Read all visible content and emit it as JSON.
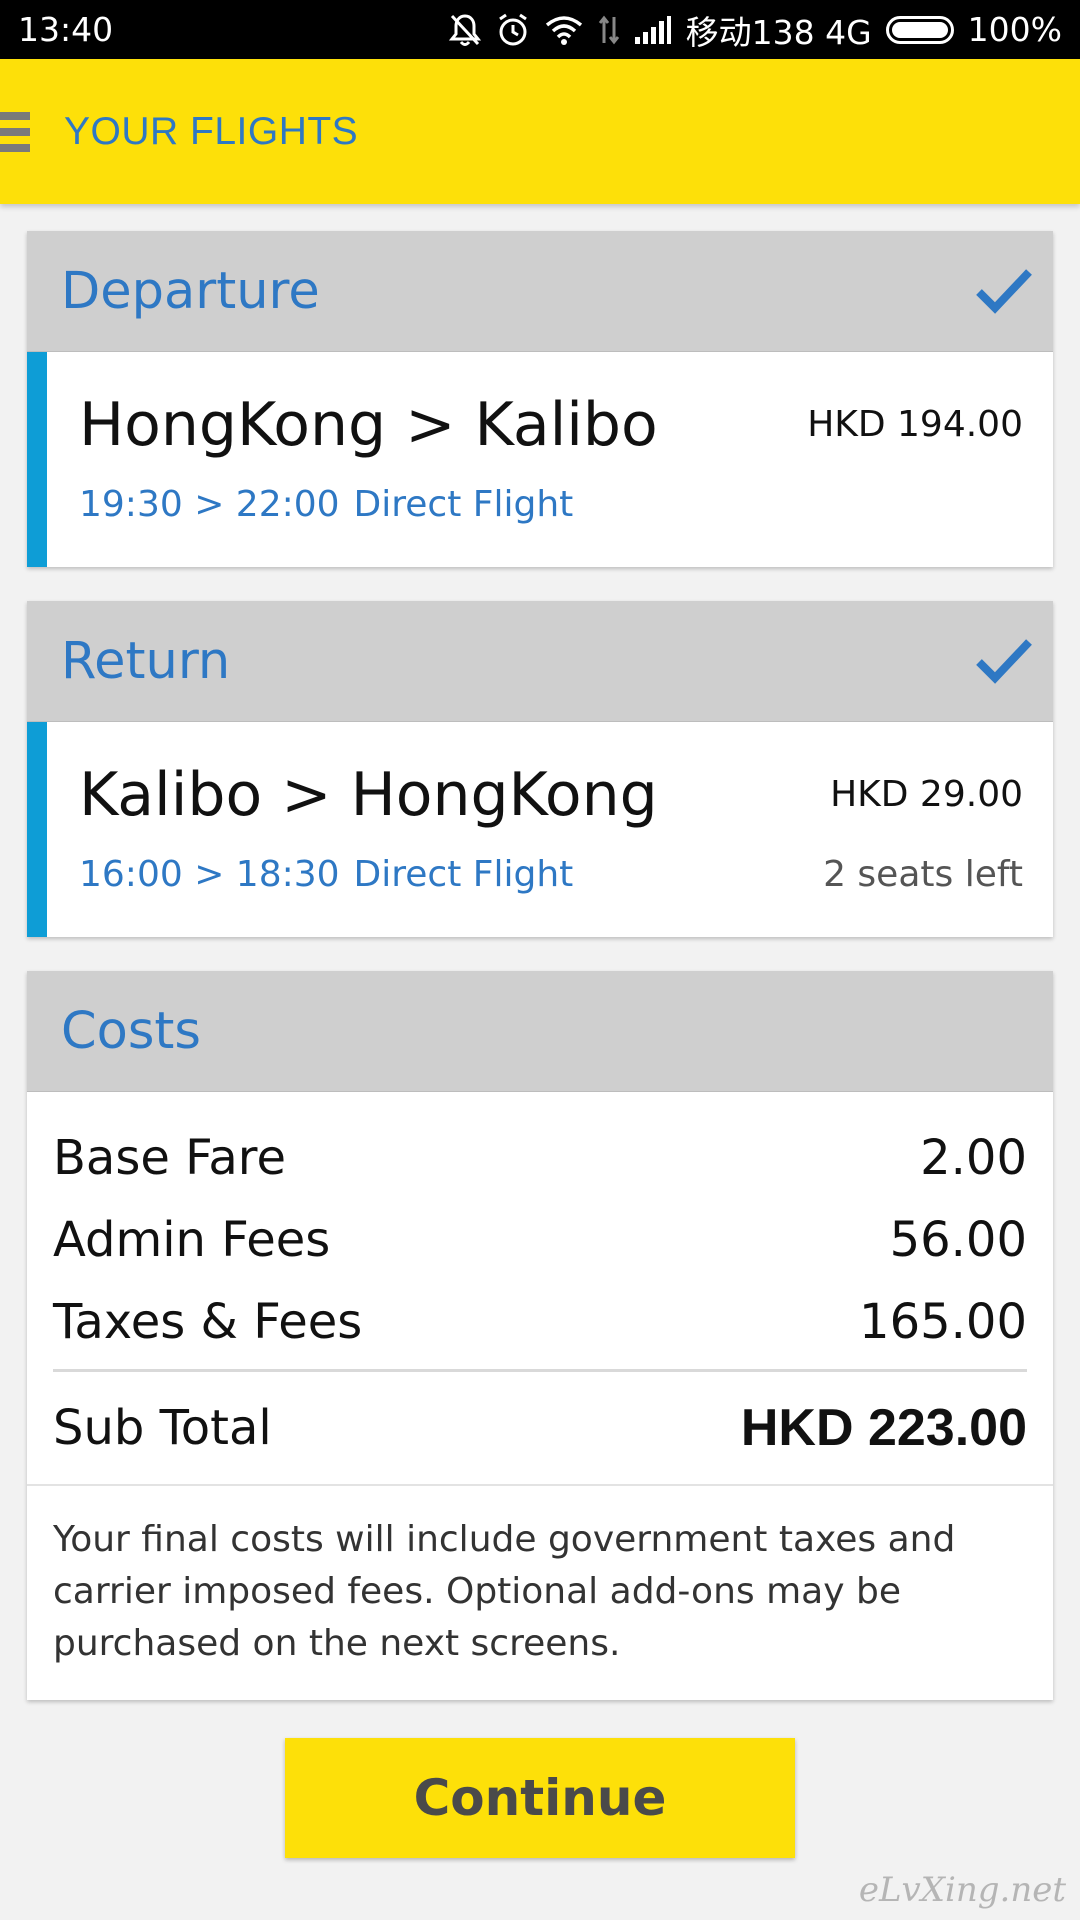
{
  "status_bar": {
    "time": "13:40",
    "carrier": "移动138 4G",
    "battery": "100%",
    "icons": [
      "mute-bell-icon",
      "alarm-icon",
      "wifi-icon",
      "data-arrows-icon",
      "signal-icon",
      "battery-icon"
    ]
  },
  "app_bar": {
    "title": "YOUR FLIGHTS",
    "menu_icon": "hamburger-menu-icon"
  },
  "departure": {
    "header": "Departure",
    "route": "HongKong > Kalibo",
    "price": "HKD 194.00",
    "times": "19:30 > 22:00",
    "flight_type": "Direct Flight",
    "selected": true
  },
  "return": {
    "header": "Return",
    "route": "Kalibo > HongKong",
    "price": "HKD 29.00",
    "times": "16:00 > 18:30",
    "flight_type": "Direct Flight",
    "seats_left": "2 seats left",
    "selected": true
  },
  "costs": {
    "header": "Costs",
    "rows": [
      {
        "label": "Base Fare",
        "value": "2.00"
      },
      {
        "label": "Admin Fees",
        "value": "56.00"
      },
      {
        "label": "Taxes & Fees",
        "value": "165.00"
      }
    ],
    "subtotal_label": "Sub Total",
    "subtotal_value": "HKD 223.00",
    "note": "Your final costs will include government taxes and carrier imposed fees. Optional add-ons may be purchased on the next screens."
  },
  "continue_label": "Continue",
  "watermark": "eLvXing.net",
  "colors": {
    "accent_yellow": "#fde009",
    "link_blue": "#2e78c4",
    "flight_bar_blue": "#0e9dd6",
    "header_gray": "#cfcfcf"
  }
}
